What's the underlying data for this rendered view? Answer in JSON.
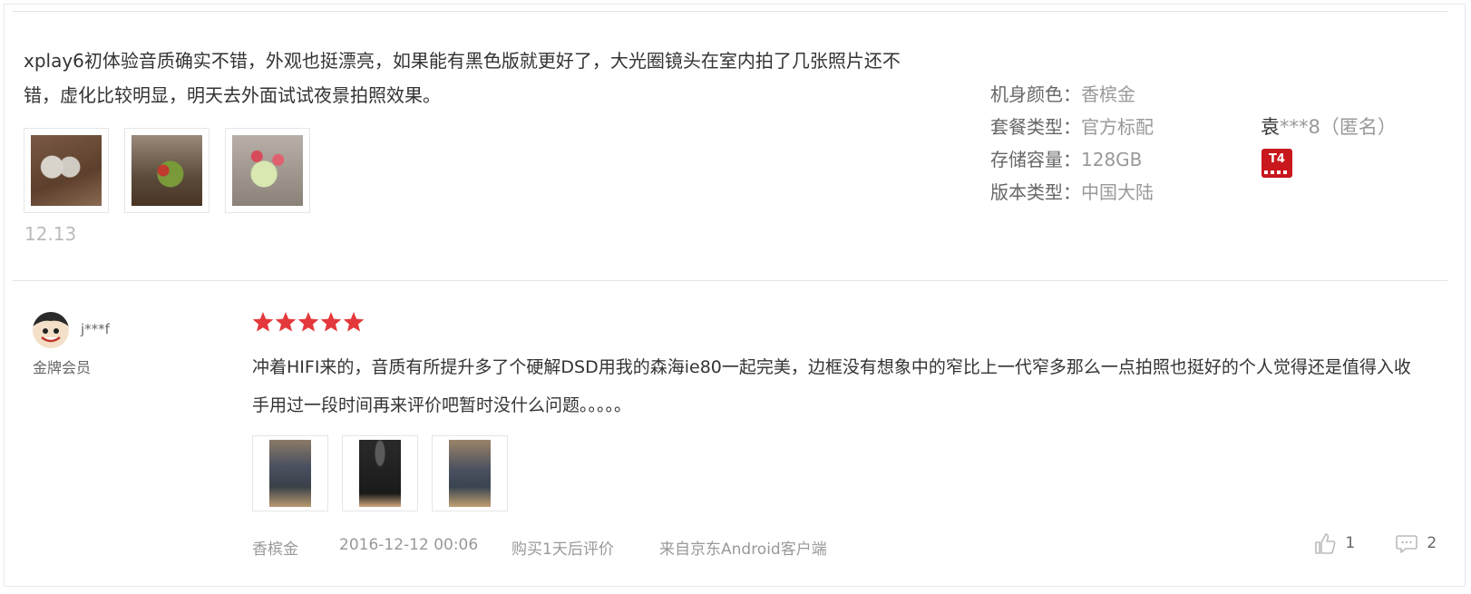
{
  "review1": {
    "text": "xplay6初体验音质确实不错，外观也挺漂亮，如果能有黑色版就更好了，大光圈镜头在室内拍了几张照片还不错，虚化比较明显，明天去外面试试夜景拍照效果。",
    "date": "12.13",
    "attributes": [
      {
        "key": "机身颜色：",
        "value": "香槟金"
      },
      {
        "key": "套餐类型：",
        "value": "官方标配"
      },
      {
        "key": "存储容量：",
        "value": "128GB"
      },
      {
        "key": "版本类型：",
        "value": "中国大陆"
      }
    ],
    "user_name": "袁",
    "user_mask": "***8",
    "user_anon": "（匿名）",
    "level_badge": "T4",
    "thumb_count": 3
  },
  "review2": {
    "user_name": "j***f",
    "user_level": "金牌会员",
    "rating": 5,
    "text": "冲着HIFI来的，音质有所提升多了个硬解DSD用我的森海ie80一起完美，边框没有想象中的窄比上一代窄多那么一点拍照也挺好的个人觉得还是值得入收手用过一段时间再来评价吧暂时没什么问题。。。。。",
    "color": "香槟金",
    "datetime": "2016-12-12 00:06",
    "purchase_note": "购买1天后评价",
    "source": "来自京东Android客户端",
    "likes": "1",
    "replies": "2",
    "thumb_count": 3
  },
  "colors": {
    "star": "#e4393c",
    "badge": "#c8171d",
    "divider": "#e4e4e4",
    "muted": "#999999"
  },
  "icons": {
    "like": "thumbs-up-icon",
    "reply": "comment-icon",
    "star": "star-icon"
  }
}
